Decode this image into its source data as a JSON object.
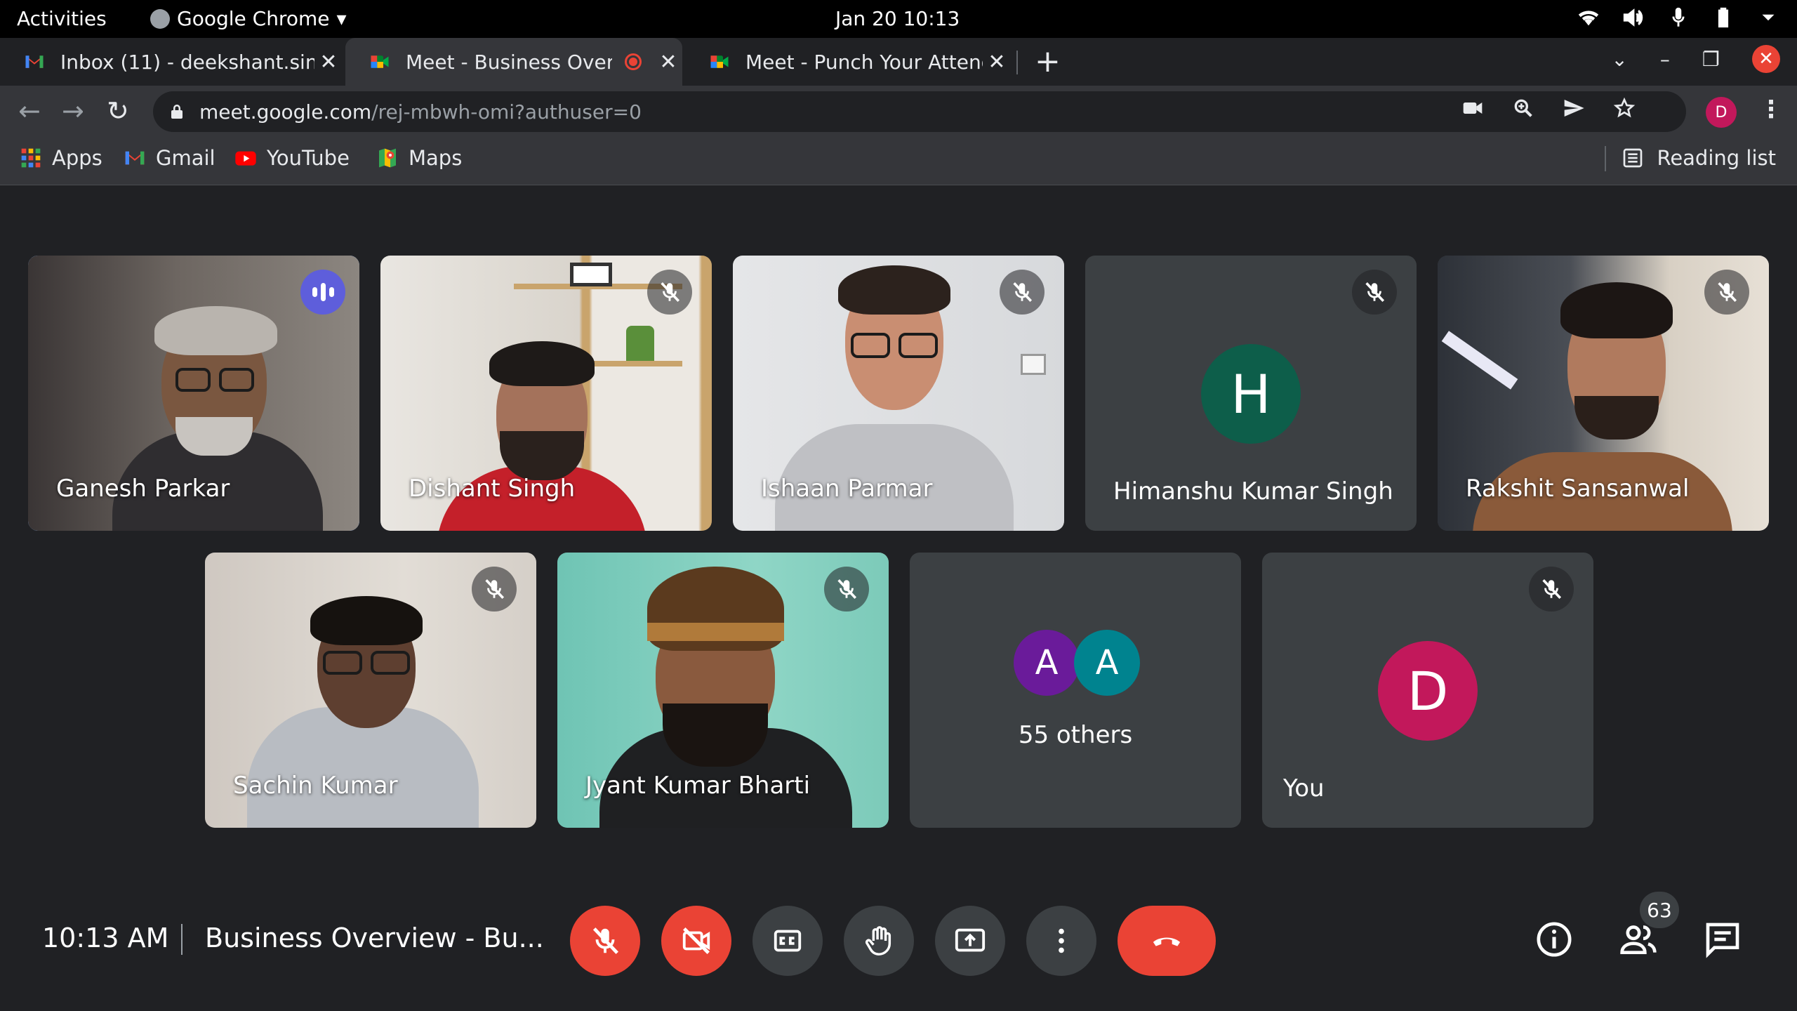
{
  "os_bar": {
    "activities": "Activities",
    "app_name": "Google Chrome",
    "clock": "Jan 20  10:13"
  },
  "tabs": [
    {
      "title": "Inbox (11) - deekshant.sin",
      "favicon": "gmail-icon"
    },
    {
      "title": "Meet - Business Overv",
      "favicon": "meet-icon",
      "recording": true
    },
    {
      "title": "Meet - Punch Your Attend",
      "favicon": "meet-icon"
    }
  ],
  "omnibox": {
    "host": "meet.google.com",
    "path": "/rej-mbwh-omi?authuser=0"
  },
  "profile_initial": "D",
  "bookmarks": [
    {
      "label": "Apps",
      "icon": "apps-grid-icon"
    },
    {
      "label": "Gmail",
      "icon": "gmail-icon"
    },
    {
      "label": "YouTube",
      "icon": "youtube-icon"
    },
    {
      "label": "Maps",
      "icon": "maps-icon"
    }
  ],
  "reading_list": "Reading list",
  "participants": [
    {
      "name": "Ganesh Parkar",
      "speaking": true
    },
    {
      "name": "Dishant Singh",
      "muted": true
    },
    {
      "name": "Ishaan Parmar",
      "muted": true
    },
    {
      "name": "Himanshu Kumar Singh",
      "initial": "H",
      "muted": true
    },
    {
      "name": "Rakshit Sansanwal",
      "muted": true
    },
    {
      "name": "Sachin Kumar",
      "muted": true
    },
    {
      "name": "Jyant Kumar Bharti",
      "muted": true
    }
  ],
  "others": {
    "initials": [
      "A",
      "A"
    ],
    "label": "55 others"
  },
  "self_tile": {
    "initial": "D",
    "label": "You"
  },
  "call_bar": {
    "time": "10:13 AM",
    "title": "Business Overview - Bu...",
    "people_count": "63"
  },
  "colors": {
    "accent_red": "#ea4335",
    "speaking_outline": "#8ab4f8",
    "avatar_h": "#0d5e4a",
    "avatar_a1": "#6a1b9a",
    "avatar_a2": "#00838f",
    "avatar_d": "#c2185b"
  }
}
